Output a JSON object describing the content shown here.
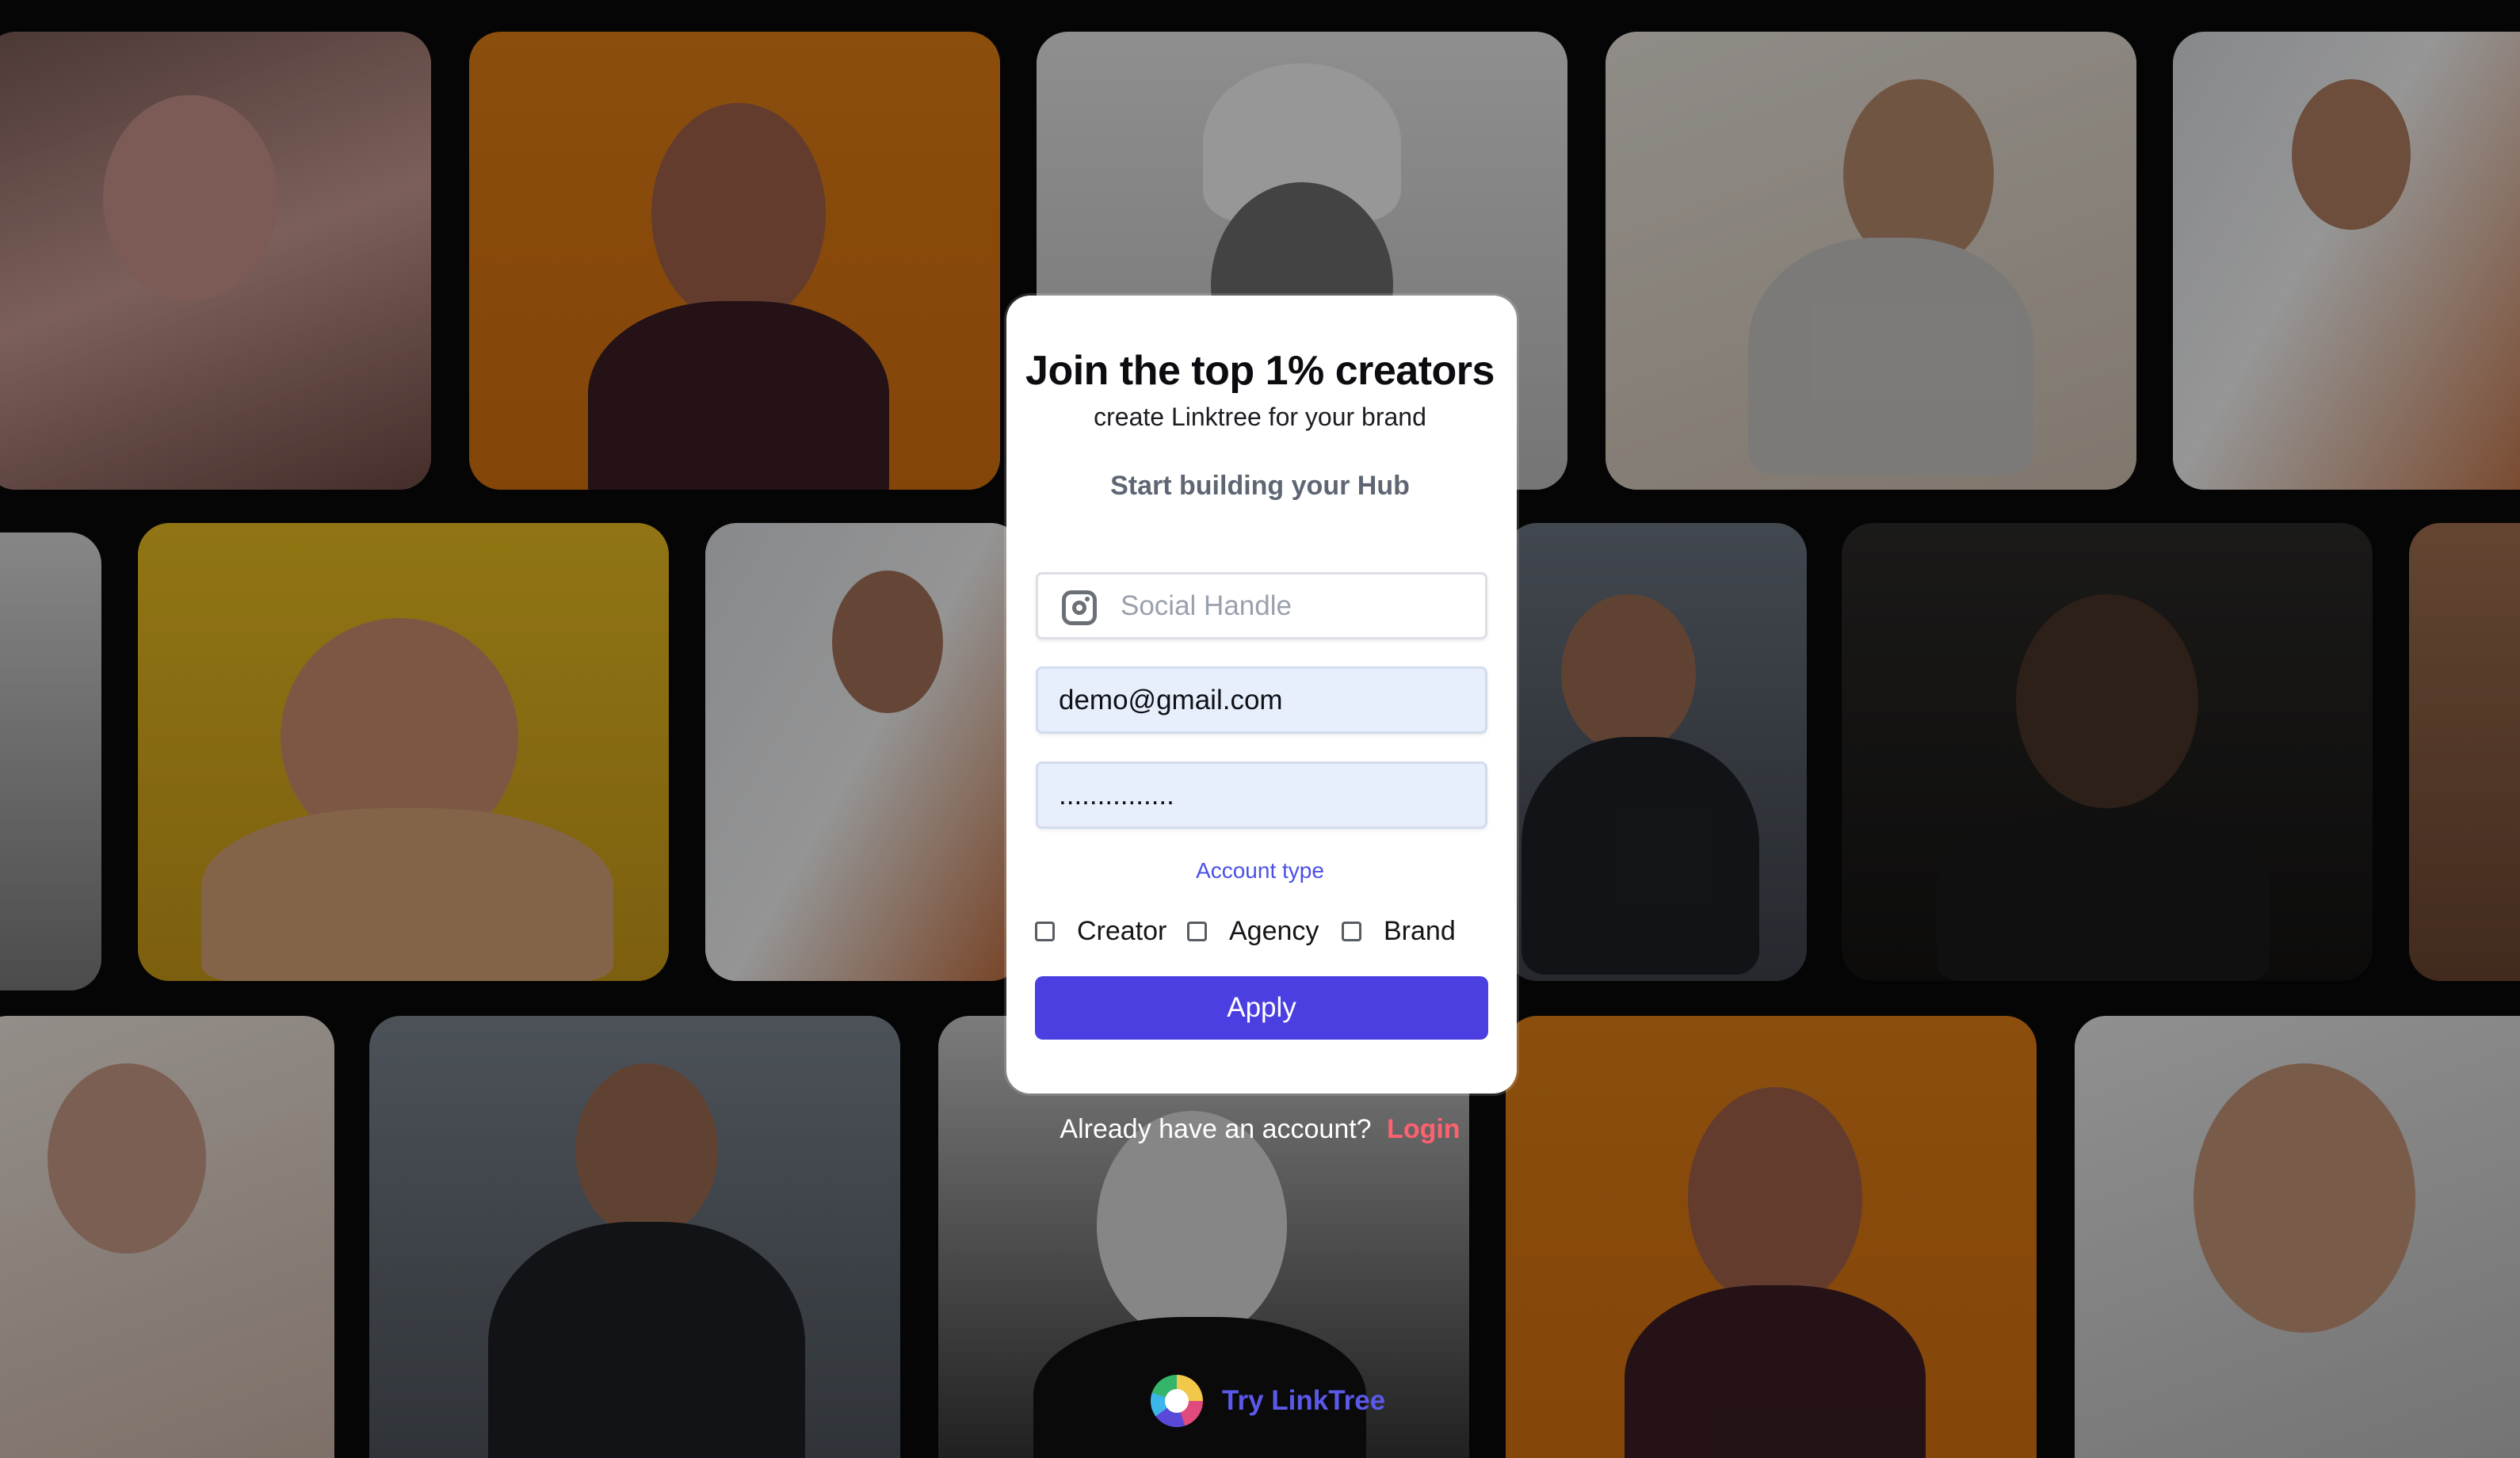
{
  "modal": {
    "title": "Join the top 1% creators",
    "subtitle": "create Linktree for your brand",
    "section_heading": "Start building your Hub",
    "social_handle": {
      "placeholder": "Social Handle",
      "value": "",
      "icon": "instagram-icon"
    },
    "email": {
      "value": "demo@gmail.com"
    },
    "password": {
      "value": "..............."
    },
    "account_type_label": "Account type",
    "account_options": [
      {
        "label": "Creator",
        "checked": false
      },
      {
        "label": "Agency",
        "checked": false
      },
      {
        "label": "Brand",
        "checked": false
      }
    ],
    "apply_label": "Apply"
  },
  "footer": {
    "login_prompt": "Already have an account?",
    "login_link": "Login",
    "try_label": "Try LinkTree",
    "try_icon": "linktree-logo-icon"
  },
  "colors": {
    "accent": "#4b3fe2",
    "login_link": "#ff6170",
    "input_filled_bg": "#e8effc",
    "try_label": "#5b59ea"
  }
}
